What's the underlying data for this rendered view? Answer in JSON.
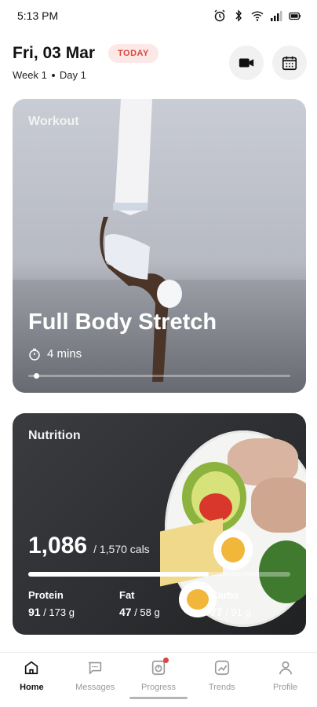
{
  "status_bar": {
    "time": "5:13 PM",
    "icons": [
      "alarm-icon",
      "bluetooth-icon",
      "wifi-icon",
      "signal-icon",
      "battery-icon"
    ]
  },
  "header": {
    "date": "Fri, 03 Mar",
    "today_badge": "TODAY",
    "week": "Week 1",
    "day": "Day 1",
    "buttons": [
      "video-camera-icon",
      "calendar-icon"
    ]
  },
  "workout": {
    "label": "Workout",
    "title": "Full Body Stretch",
    "duration": "4 mins",
    "progress": 0.02
  },
  "nutrition": {
    "label": "Nutrition",
    "calories": "1,086",
    "calories_target": "/ 1,570 cals",
    "calorie_progress": 0.69,
    "macros": [
      {
        "label": "Protein",
        "value": "91",
        "target": "/ 173 g"
      },
      {
        "label": "Fat",
        "value": "47",
        "target": "/ 58 g"
      },
      {
        "label": "Carbs",
        "value": "77",
        "target": "/ 91 g"
      }
    ]
  },
  "bottom_nav": {
    "items": [
      {
        "label": "Home",
        "icon": "home-icon",
        "active": true
      },
      {
        "label": "Messages",
        "icon": "chat-icon",
        "active": false
      },
      {
        "label": "Progress",
        "icon": "progress-icon",
        "active": false
      },
      {
        "label": "Trends",
        "icon": "trends-icon",
        "active": false
      },
      {
        "label": "Profile",
        "icon": "user-icon",
        "active": false
      }
    ]
  },
  "colors": {
    "accent": "#e0443e",
    "badge_bg": "#fde8e8"
  }
}
